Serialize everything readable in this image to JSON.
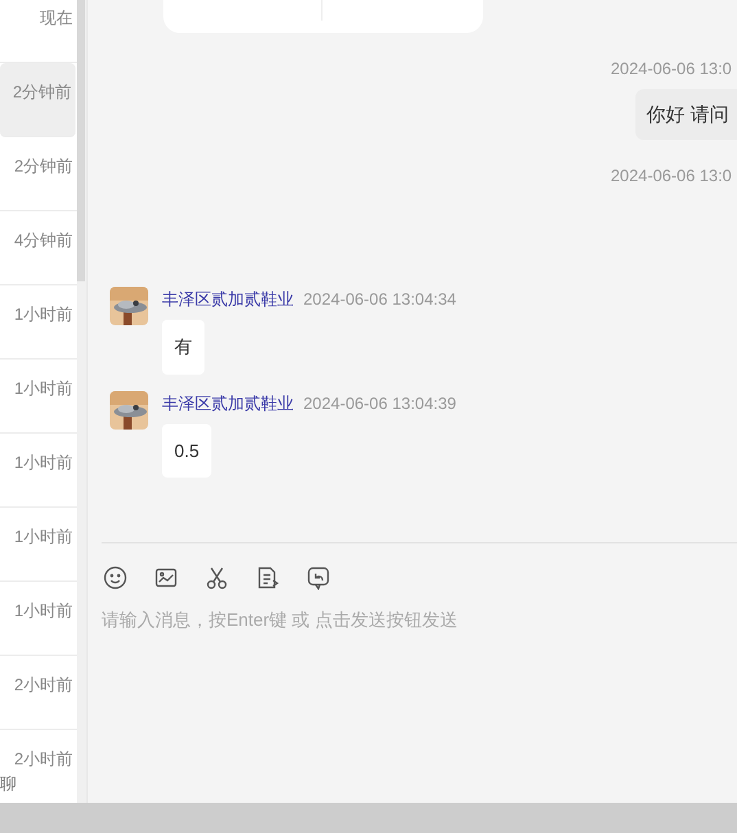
{
  "sidebar": {
    "items": [
      {
        "time": "现在",
        "selected": false
      },
      {
        "time": "2分钟前",
        "selected": true
      },
      {
        "time": "2分钟前",
        "selected": false
      },
      {
        "time": "4分钟前",
        "selected": false
      },
      {
        "time": "1小时前",
        "selected": false
      },
      {
        "time": "1小时前",
        "selected": false
      },
      {
        "time": "1小时前",
        "selected": false
      },
      {
        "time": "1小时前",
        "selected": false
      },
      {
        "time": "1小时前",
        "selected": false
      },
      {
        "time": "2小时前",
        "selected": false
      },
      {
        "time": "2小时前",
        "selected": false
      }
    ],
    "footer": "聊"
  },
  "messages": [
    {
      "kind": "mine",
      "time": "2024-06-06 13:0",
      "text": "你好 请问"
    },
    {
      "kind": "mine-empty",
      "time": "2024-06-06 13:0"
    },
    {
      "kind": "theirs",
      "sender": "丰泽区贰加贰鞋业",
      "time": "2024-06-06 13:04:34",
      "text": "有"
    },
    {
      "kind": "theirs",
      "sender": "丰泽区贰加贰鞋业",
      "time": "2024-06-06 13:04:39",
      "text": "0.5"
    }
  ],
  "composer": {
    "placeholder": "请输入消息，按Enter键 或 点击发送按钮发送"
  }
}
